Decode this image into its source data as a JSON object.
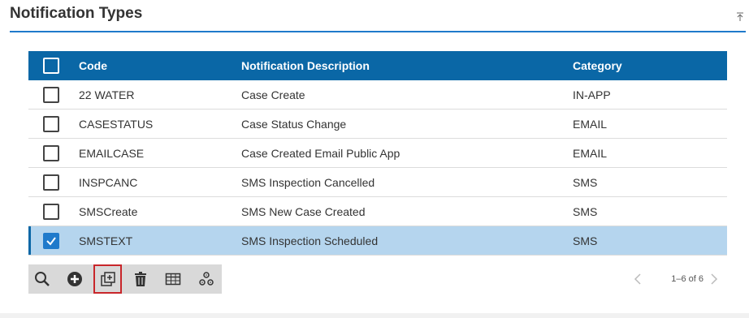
{
  "panel": {
    "title": "Notification Types"
  },
  "grid": {
    "columns": [
      "Code",
      "Notification Description",
      "Category"
    ],
    "rows": [
      {
        "code": "22 WATER",
        "description": "Case Create",
        "category": "IN-APP",
        "checked": false
      },
      {
        "code": "CASESTATUS",
        "description": "Case Status Change",
        "category": "EMAIL",
        "checked": false
      },
      {
        "code": "EMAILCASE",
        "description": "Case Created Email Public App",
        "category": "EMAIL",
        "checked": false
      },
      {
        "code": "INSPCANC",
        "description": "SMS Inspection Cancelled",
        "category": "SMS",
        "checked": false
      },
      {
        "code": "SMSCreate",
        "description": "SMS New Case Created",
        "category": "SMS",
        "checked": false
      },
      {
        "code": "SMSTEXT",
        "description": "SMS Inspection Scheduled",
        "category": "SMS",
        "checked": true
      }
    ]
  },
  "toolbar": {
    "buttons": [
      "search-icon",
      "add-icon",
      "copy-add-icon",
      "trash-icon",
      "table-columns-icon",
      "settings-gears-icon"
    ]
  },
  "pager": {
    "label": "1–6 of 6"
  },
  "colors": {
    "accent": "#1f7acb",
    "header_bg": "#0a67a6",
    "selected_row": "#b5d5ee",
    "highlight": "#c8262a"
  }
}
